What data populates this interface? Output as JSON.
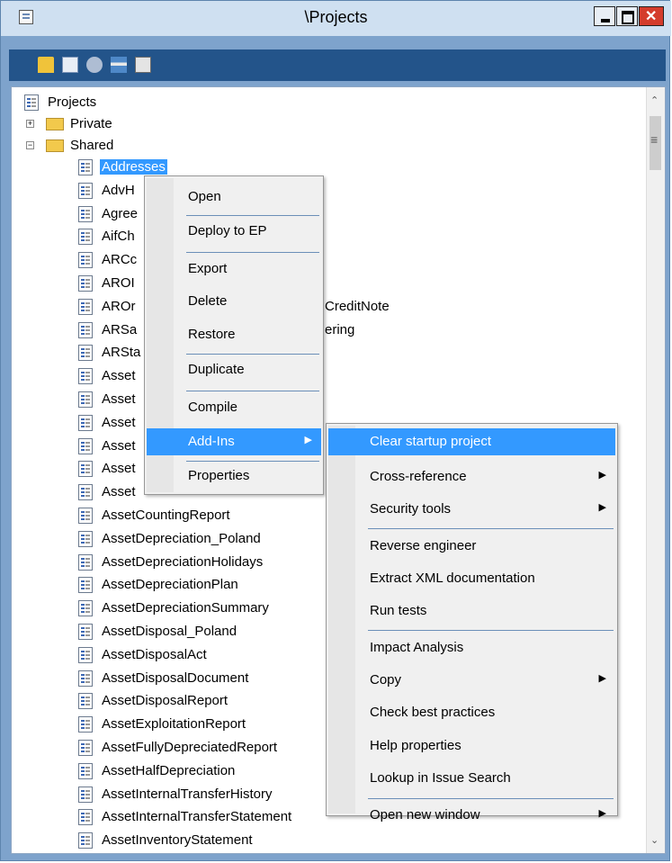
{
  "window": {
    "title": "\\Projects"
  },
  "tree": {
    "root": "Projects",
    "private": "Private",
    "shared": "Shared",
    "items": [
      {
        "label": "Addresses",
        "selected": true
      },
      {
        "label": "AdvH"
      },
      {
        "label": "Agree"
      },
      {
        "label": "AifCh"
      },
      {
        "label": "ARCc"
      },
      {
        "label": "AROI"
      },
      {
        "label": "AROr",
        "tail": "CreditNote"
      },
      {
        "label": "ARSa",
        "tail": "ering"
      },
      {
        "label": "ARSta"
      },
      {
        "label": "Asset"
      },
      {
        "label": "Asset"
      },
      {
        "label": "Asset"
      },
      {
        "label": "Asset"
      },
      {
        "label": "Asset"
      },
      {
        "label": "Asset"
      },
      {
        "label": "AssetCountingReport"
      },
      {
        "label": "AssetDepreciation_Poland"
      },
      {
        "label": "AssetDepreciationHolidays"
      },
      {
        "label": "AssetDepreciationPlan"
      },
      {
        "label": "AssetDepreciationSummary"
      },
      {
        "label": "AssetDisposal_Poland"
      },
      {
        "label": "AssetDisposalAct"
      },
      {
        "label": "AssetDisposalDocument"
      },
      {
        "label": "AssetDisposalReport"
      },
      {
        "label": "AssetExploitationReport"
      },
      {
        "label": "AssetFullyDepreciatedReport"
      },
      {
        "label": "AssetHalfDepreciation"
      },
      {
        "label": "AssetInternalTransferHistory"
      },
      {
        "label": "AssetInternalTransferStatement"
      },
      {
        "label": "AssetInventoryStatement"
      }
    ]
  },
  "context_menu": {
    "items": [
      "Open",
      "Deploy to EP",
      "Export",
      "Delete",
      "Restore",
      "Duplicate",
      "Compile",
      "Add-Ins",
      "Properties"
    ]
  },
  "submenu": {
    "items": [
      "Clear startup project",
      "Cross-reference",
      "Security tools",
      "Reverse engineer",
      "Extract XML documentation",
      "Run tests",
      "Impact Analysis",
      "Copy",
      "Check best practices",
      "Help properties",
      "Lookup in Issue Search",
      "Open new window"
    ]
  },
  "colors": {
    "selection": "#3399ff",
    "toolbar": "#23548a",
    "frame": "#7ea3cc"
  }
}
